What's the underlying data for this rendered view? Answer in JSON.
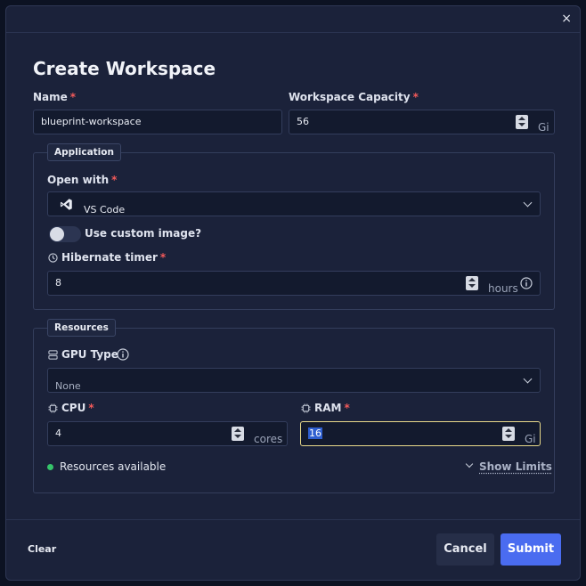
{
  "dialog": {
    "title": "Create Workspace",
    "close_glyph": "×"
  },
  "name_field": {
    "label": "Name",
    "required": "*",
    "value": "blueprint-workspace"
  },
  "capacity_field": {
    "label": "Workspace Capacity",
    "required": "*",
    "value": "56",
    "unit": "Gi"
  },
  "application": {
    "legend": "Application",
    "open_with": {
      "label": "Open with",
      "required": "*",
      "value": "VS Code",
      "icon": "vscode-icon"
    },
    "custom_image": {
      "label": "Use custom image?",
      "on": false
    },
    "hibernate": {
      "label": "Hibernate timer",
      "required": "*",
      "value": "8",
      "unit": "hours",
      "icon": "clock-icon"
    }
  },
  "resources": {
    "legend": "Resources",
    "gpu": {
      "label": "GPU Type",
      "value": "None",
      "icon": "server-icon"
    },
    "cpu": {
      "label": "CPU",
      "required": "*",
      "value": "4",
      "unit": "cores",
      "icon": "chip-icon"
    },
    "ram": {
      "label": "RAM",
      "required": "*",
      "value": "16",
      "unit": "Gi",
      "icon": "chip-icon"
    },
    "status": "Resources available",
    "show_limits": "Show Limits"
  },
  "footer": {
    "clear": "Clear",
    "cancel": "Cancel",
    "submit": "Submit"
  },
  "colors": {
    "accent": "#4a6cf0",
    "focus_border": "#e8d98a",
    "available": "#35c46a",
    "required": "#f35a5a"
  }
}
